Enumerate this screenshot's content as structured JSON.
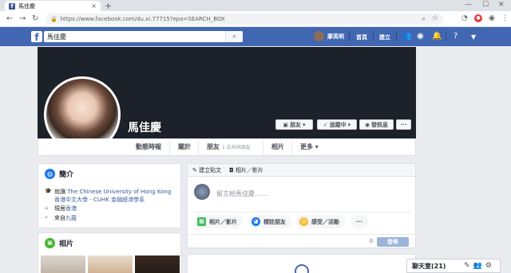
{
  "browser": {
    "tab_title": "馬佳慶",
    "url": "https://www.facebook.com/du.xi.77715?epa=SEARCH_BOX",
    "tab_close": "×",
    "new_tab": "+"
  },
  "fbbar": {
    "search_value": "馬佳慶",
    "user_name": "廖英明",
    "home": "首頁",
    "create": "建立"
  },
  "profile": {
    "name": "馬佳慶",
    "buttons": {
      "friends": "朋友",
      "following": "追蹤中",
      "message": "發訊息",
      "more": "···"
    },
    "nav": {
      "timeline": "動態時報",
      "about": "關於",
      "friends": "朋友",
      "friends_sub": "1 位共同朋友",
      "photos": "相片",
      "more": "更多"
    }
  },
  "intro": {
    "title": "簡介",
    "study_prefix": "就讀",
    "school": "The Chinese University of Hong Kong",
    "department": "香港中文大學 - CUHK 金融經濟學系",
    "lives_prefix": "現居",
    "lives_in": "香港",
    "from_prefix": "來自",
    "from": "九龍"
  },
  "photos": {
    "title": "相片"
  },
  "composer": {
    "tab_post": "建立貼文",
    "tab_photo": "相片／影片",
    "placeholder": "留言給馬佳慶……",
    "chip_photo": "相片／影片",
    "chip_tag": "標註朋友",
    "chip_feeling": "感受／活動",
    "chip_more": "···",
    "post_button": "發佈"
  },
  "chat": {
    "label": "聊天室(21)"
  },
  "colors": {
    "facebook_blue": "#4267b2",
    "link": "#385898"
  }
}
